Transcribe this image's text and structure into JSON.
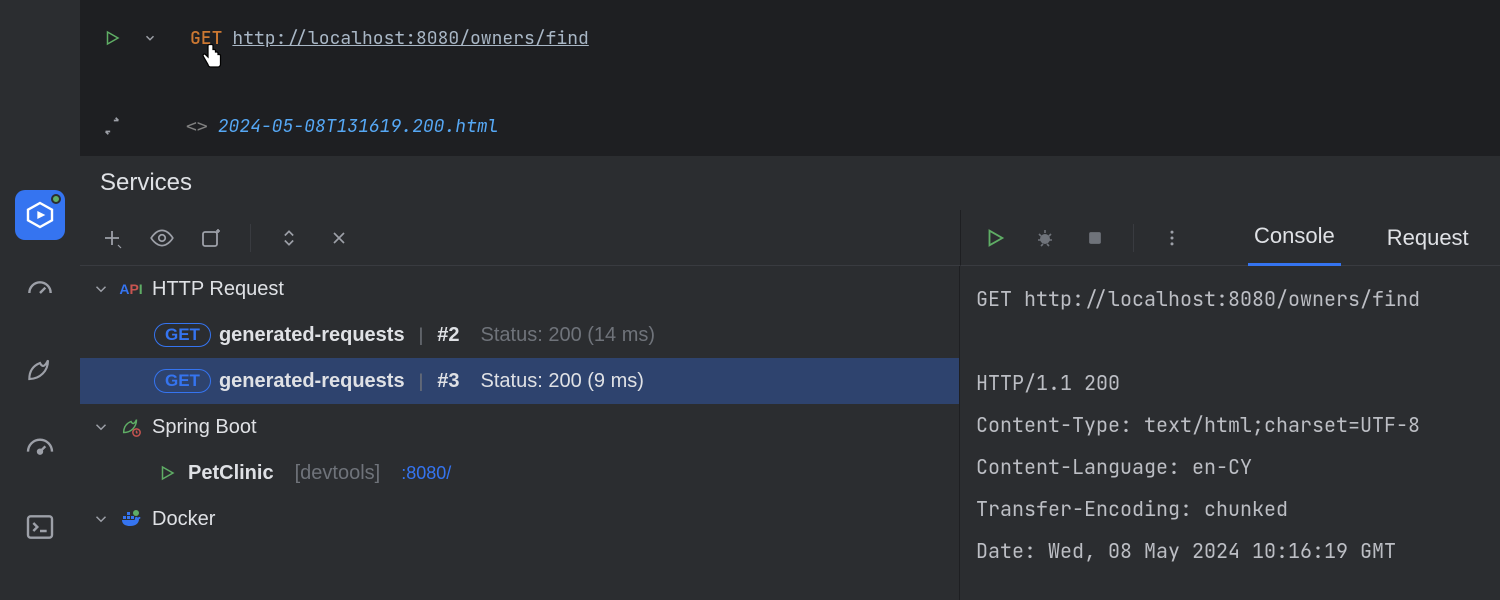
{
  "editor": {
    "method": "GET",
    "url": "http://localhost:8080/owners/find",
    "response_file": "2024-05-08T131619.200.html"
  },
  "panel_title": "Services",
  "tree": {
    "http_request": "HTTP Request",
    "entries": [
      {
        "method": "GET",
        "name": "generated-requests",
        "run": "#2",
        "status": "Status: 200 (14 ms)",
        "selected": false
      },
      {
        "method": "GET",
        "name": "generated-requests",
        "run": "#3",
        "status": "Status: 200 (9 ms)",
        "selected": true
      }
    ],
    "spring": {
      "label": "Spring Boot",
      "app": "PetClinic",
      "profile": "[devtools]",
      "port": ":8080/"
    },
    "docker": "Docker"
  },
  "detail": {
    "tabs": {
      "console": "Console",
      "request": "Request"
    },
    "lines": [
      "GET http://localhost:8080/owners/find",
      "",
      "HTTP/1.1 200 ",
      "Content-Type: text/html;charset=UTF-8",
      "Content-Language: en-CY",
      "Transfer-Encoding: chunked",
      "Date: Wed, 08 May 2024 10:16:19 GMT"
    ]
  }
}
